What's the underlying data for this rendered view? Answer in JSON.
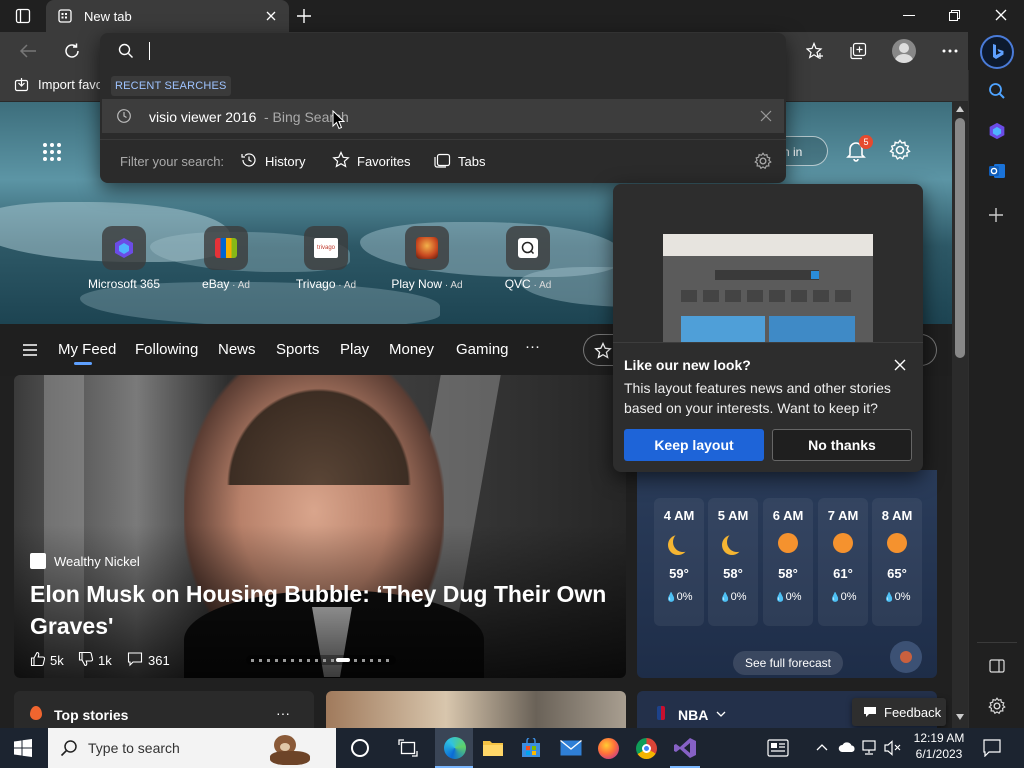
{
  "browser": {
    "tab_title": "New tab",
    "favorites_bar": {
      "import_label": "Import favo"
    },
    "omnibox": {
      "recent_header": "RECENT SEARCHES",
      "recent_query": "visio viewer 2016",
      "recent_suffix": "- Bing Search",
      "filter_label": "Filter your search:",
      "filters": [
        "History",
        "Favorites",
        "Tabs"
      ]
    }
  },
  "hero": {
    "signin_label": "n in",
    "notification_count": "5",
    "quick_links": [
      {
        "label": "Microsoft 365",
        "ad": ""
      },
      {
        "label": "eBay",
        "ad": "Ad"
      },
      {
        "label": "Trivago",
        "ad": "Ad"
      },
      {
        "label": "Play Now",
        "ad": "Ad"
      },
      {
        "label": "QVC",
        "ad": "Ad"
      }
    ],
    "trivago_logo_text": "trivago"
  },
  "feed_nav": {
    "items": [
      "My Feed",
      "Following",
      "News",
      "Sports",
      "Play",
      "Money",
      "Gaming",
      "···"
    ]
  },
  "article": {
    "source": "Wealthy Nickel",
    "headline": "Elon Musk on Housing Bubble: ‘They Dug Their Own Graves'",
    "likes": "5k",
    "dislikes": "1k",
    "comments": "361"
  },
  "popup": {
    "title": "Like our new look?",
    "body": "This layout features news and other stories based on your interests. Want to keep it?",
    "keep_label": "Keep layout",
    "decline_label": "No thanks"
  },
  "weather": {
    "hours": [
      {
        "time": "4 AM",
        "icon": "moon",
        "temp": "59°",
        "precip": "0%"
      },
      {
        "time": "5 AM",
        "icon": "moon",
        "temp": "58°",
        "precip": "0%"
      },
      {
        "time": "6 AM",
        "icon": "sun",
        "temp": "58°",
        "precip": "0%"
      },
      {
        "time": "7 AM",
        "icon": "sun",
        "temp": "61°",
        "precip": "0%"
      },
      {
        "time": "8 AM",
        "icon": "sun",
        "temp": "65°",
        "precip": "0%"
      }
    ],
    "forecast_label": "See full forecast"
  },
  "bottom": {
    "top_stories": "Top stories",
    "more": "···",
    "nba": "NBA",
    "feedback": "Feedback"
  },
  "taskbar": {
    "search_placeholder": "Type to search",
    "time": "12:19 AM",
    "date": "6/1/2023"
  },
  "colors": {
    "accent_blue": "#1e64d8",
    "notification_badge": "#e64a2e",
    "sun": "#f5922e",
    "moon": "#f5b532"
  }
}
